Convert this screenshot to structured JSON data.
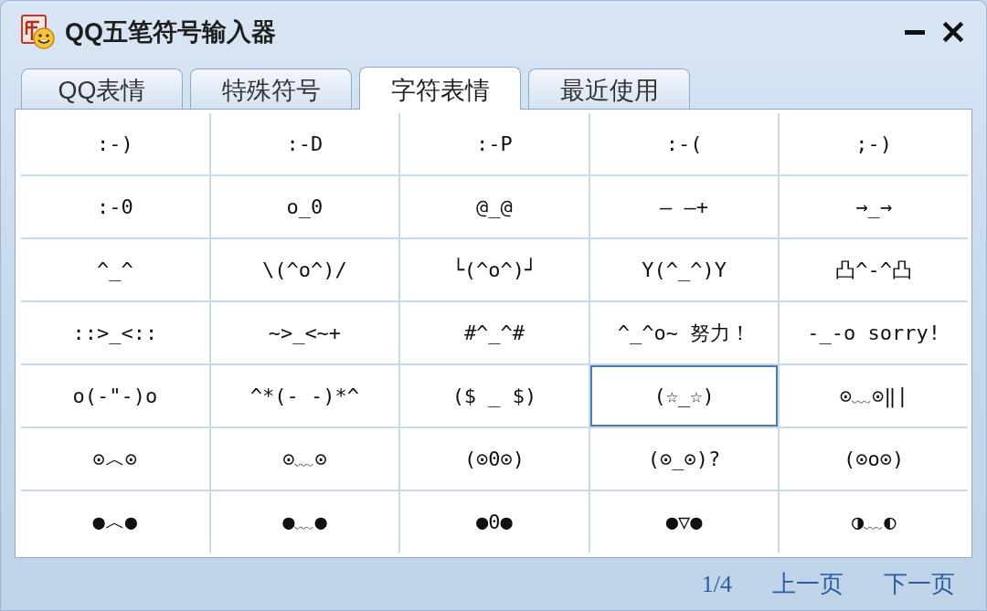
{
  "window": {
    "title": "QQ五笔符号输入器"
  },
  "tabs": [
    {
      "label": "QQ表情",
      "selected": false
    },
    {
      "label": "特殊符号",
      "selected": false
    },
    {
      "label": "字符表情",
      "selected": true
    },
    {
      "label": "最近使用",
      "selected": false
    }
  ],
  "emoticons": [
    {
      "text": ":-)",
      "selected": false
    },
    {
      "text": ":-D",
      "selected": false
    },
    {
      "text": ":-P",
      "selected": false
    },
    {
      "text": ":-(",
      "selected": false
    },
    {
      "text": ";-)",
      "selected": false
    },
    {
      "text": ":-0",
      "selected": false
    },
    {
      "text": "o_0",
      "selected": false
    },
    {
      "text": "@_@",
      "selected": false
    },
    {
      "text": "— —+",
      "selected": false
    },
    {
      "text": "→_→",
      "selected": false
    },
    {
      "text": "^_^",
      "selected": false
    },
    {
      "text": "\\(^o^)/",
      "selected": false
    },
    {
      "text": "└(^o^)┘",
      "selected": false
    },
    {
      "text": "Y(^_^)Y",
      "selected": false
    },
    {
      "text": "凸^-^凸",
      "selected": false
    },
    {
      "text": "::>_<::",
      "selected": false
    },
    {
      "text": "~>_<~+",
      "selected": false
    },
    {
      "text": "#^_^#",
      "selected": false
    },
    {
      "text": "^_^o~ 努力！",
      "selected": false
    },
    {
      "text": "-_-o sorry!",
      "selected": false
    },
    {
      "text": "o(-\"-)o",
      "selected": false
    },
    {
      "text": "^*(- -)*^",
      "selected": false
    },
    {
      "text": "($ _ $)",
      "selected": false
    },
    {
      "text": "(☆_☆)",
      "selected": true
    },
    {
      "text": "⊙﹏⊙‖∣",
      "selected": false
    },
    {
      "text": "⊙︿⊙",
      "selected": false
    },
    {
      "text": "⊙﹏⊙",
      "selected": false
    },
    {
      "text": "(⊙0⊙)",
      "selected": false
    },
    {
      "text": "(⊙_⊙)?",
      "selected": false
    },
    {
      "text": "(⊙o⊙)",
      "selected": false
    },
    {
      "text": "●︿●",
      "selected": false
    },
    {
      "text": "●﹏●",
      "selected": false
    },
    {
      "text": "●0●",
      "selected": false
    },
    {
      "text": "●▽●",
      "selected": false
    },
    {
      "text": "◑﹏◐",
      "selected": false
    }
  ],
  "pager": {
    "page": "1/4",
    "prev": "上一页",
    "next": "下一页"
  }
}
